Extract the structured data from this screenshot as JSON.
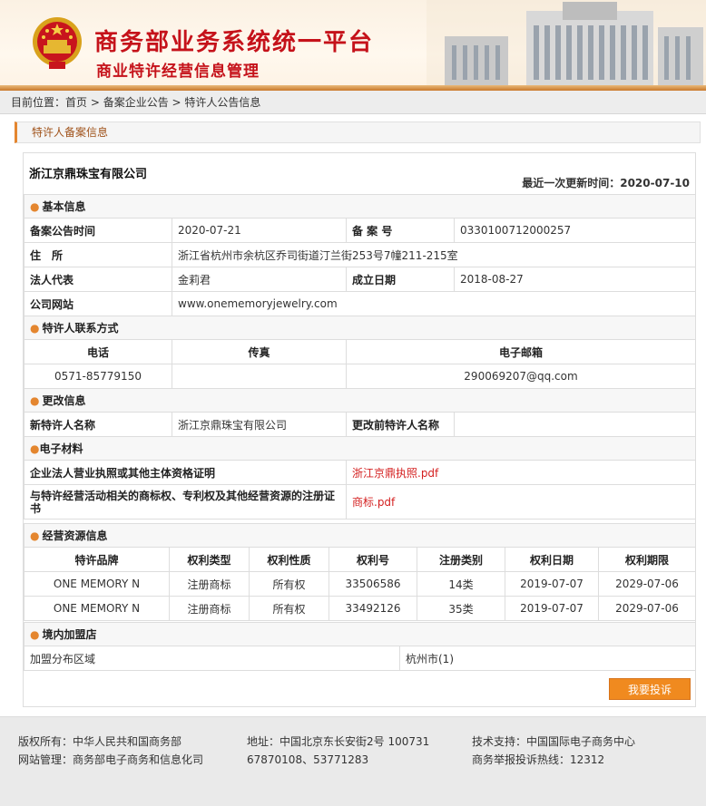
{
  "header": {
    "title": "商务部业务系统统一平台",
    "subtitle": "商业特许经营信息管理",
    "brand_color": "#c5121a"
  },
  "breadcrumb": {
    "prefix": "目前位置：",
    "items": [
      "首页",
      "备案企业公告",
      "特许人公告信息"
    ],
    "separator": " > "
  },
  "section_title": "特许人备案信息",
  "company": {
    "name": "浙江京鼎珠宝有限公司",
    "updated_label": "最近一次更新时间：",
    "updated_value": "2020-07-10"
  },
  "basic": {
    "heading": "基本信息",
    "record_time_label": "备案公告时间",
    "record_time": "2020-07-21",
    "record_no_label": "备 案 号",
    "record_no": "0330100712000257",
    "address_label": "住　所",
    "address": "浙江省杭州市余杭区乔司街道汀兰街253号7幢211-215室",
    "legal_rep_label": "法人代表",
    "legal_rep": "金莉君",
    "founded_label": "成立日期",
    "founded": "2018-08-27",
    "website_label": "公司网站",
    "website": "www.onememoryjewelry.com"
  },
  "contact": {
    "heading": "特许人联系方式",
    "phone_label": "电话",
    "fax_label": "传真",
    "email_label": "电子邮箱",
    "phone": "0571-85779150",
    "fax": "",
    "email": "290069207@qq.com"
  },
  "change": {
    "heading": "更改信息",
    "new_name_label": "新特许人名称",
    "new_name": "浙江京鼎珠宝有限公司",
    "old_name_label": "更改前特许人名称",
    "old_name": ""
  },
  "materials": {
    "heading": "电子材料",
    "license_label": "企业法人营业执照或其他主体资格证明",
    "license_file": "浙江京鼎执照.pdf",
    "trademark_label": "与特许经营活动相关的商标权、专利权及其他经营资源的注册证书",
    "trademark_file": "商标.pdf"
  },
  "resources": {
    "heading": "经营资源信息",
    "columns": [
      "特许品牌",
      "权利类型",
      "权利性质",
      "权利号",
      "注册类别",
      "权利日期",
      "权利期限"
    ],
    "rows": [
      [
        "ONE MEMORY N",
        "注册商标",
        "所有权",
        "33506586",
        "14类",
        "2019-07-07",
        "2029-07-06"
      ],
      [
        "ONE MEMORY N",
        "注册商标",
        "所有权",
        "33492126",
        "35类",
        "2019-07-07",
        "2029-07-06"
      ]
    ]
  },
  "stores": {
    "heading": "境内加盟店",
    "region_label": "加盟分布区域",
    "region_value": "杭州市(1)"
  },
  "complaint_button": "我要投诉",
  "footer": {
    "copyright": "版权所有：中华人民共和国商务部",
    "manager": "网站管理：商务部电子商务和信息化司",
    "address": "地址：中国北京东长安街2号 100731",
    "phones": "67870108、53771283",
    "support": "技术支持：中国国际电子商务中心",
    "hotline": "商务举报投诉热线：12312"
  }
}
